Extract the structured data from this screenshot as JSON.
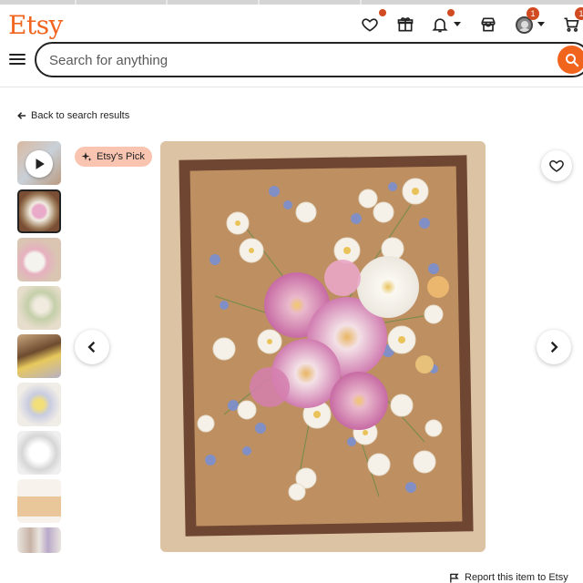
{
  "header": {
    "logo": "Etsy",
    "icons": [
      "heart-icon",
      "gift-icon",
      "bell-icon",
      "shop-icon",
      "avatar"
    ],
    "cart_count": "1",
    "avatar_count": "1"
  },
  "search": {
    "placeholder": "Search for anything"
  },
  "nav": {
    "back_label": "Back to search results"
  },
  "listing": {
    "pick_label": "Etsy's Pick",
    "thumbnail_count": 9,
    "selected_thumbnail": 2
  },
  "footer": {
    "report_label": "Report this item to Etsy"
  },
  "colors": {
    "brand": "#f1641e",
    "badge": "#d14a20",
    "pick_bg": "#f9c4b0"
  }
}
